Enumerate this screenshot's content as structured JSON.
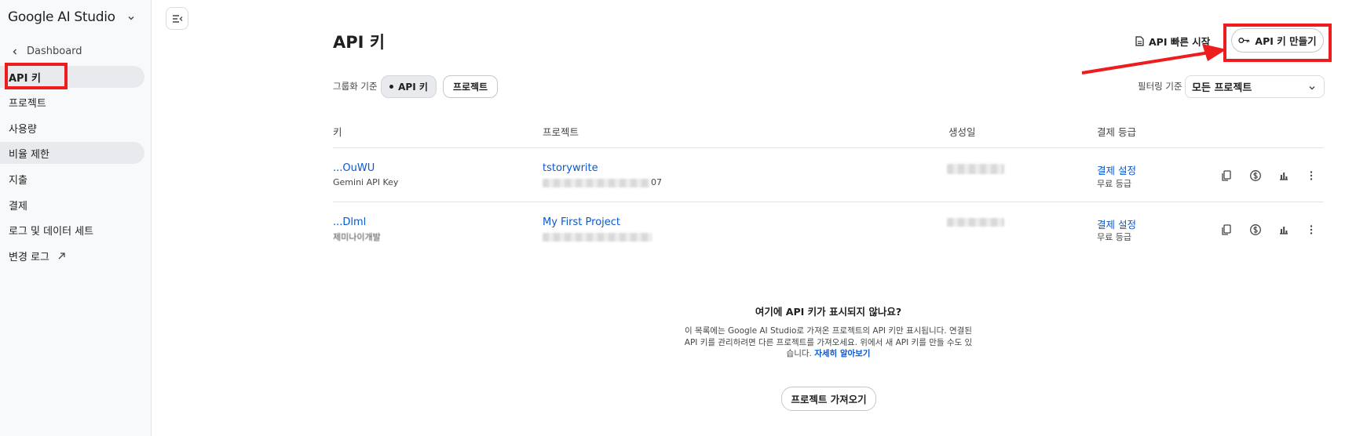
{
  "sidebar": {
    "brand": "Google AI Studio",
    "back_label": "Dashboard",
    "items": [
      {
        "label": "API 키",
        "state": "active"
      },
      {
        "label": "프로젝트",
        "state": ""
      },
      {
        "label": "사용량",
        "state": ""
      },
      {
        "label": "비율 제한",
        "state": "hover"
      },
      {
        "label": "지출",
        "state": ""
      },
      {
        "label": "결제",
        "state": ""
      },
      {
        "label": "로그 및 데이터 세트",
        "state": ""
      },
      {
        "label": "변경 로그",
        "state": "external"
      }
    ]
  },
  "header": {
    "title": "API 키",
    "quickstart_label": "API 빠른 시작",
    "create_label": "API 키 만들기"
  },
  "toolbar": {
    "group_label": "그룹화 기준",
    "group_options": [
      "API 키",
      "프로젝트"
    ],
    "filter_label": "필터링 기준",
    "filter_value": "모든 프로젝트"
  },
  "table": {
    "columns": [
      "키",
      "프로젝트",
      "생성일",
      "결제 등급"
    ],
    "rows": [
      {
        "key": "...OuWU",
        "key_sub": "Gemini API Key",
        "project": "tstorywrite",
        "project_sub_suffix": "07",
        "billing_link": "결제 설정",
        "billing_tier": "무료 등급"
      },
      {
        "key": "...Dlml",
        "key_sub": "제미나이개발",
        "project": "My First Project",
        "project_sub_suffix": "",
        "billing_link": "결제 설정",
        "billing_tier": "무료 등급"
      }
    ]
  },
  "empty_state": {
    "title": "여기에 API 키가 표시되지 않나요?",
    "body": "이 목록에는 Google AI Studio로 가져온 프로젝트의 API 키만 표시됩니다. 연결된 API 키를 관리하려면 다른 프로젝트를 가져오세요. 위에서 새 API 키를 만들 수도 있습니다. ",
    "learn_more": "자세히 알아보기",
    "import_label": "프로젝트 가져오기"
  },
  "icons": {
    "row_actions": [
      "copy-icon",
      "billing-icon",
      "usage-chart-icon",
      "more-vert-icon"
    ]
  },
  "colors": {
    "link": "#0b57d0",
    "annotation": "#ee1c1c",
    "sidebar_bg": "#f8f9fa",
    "active_bg": "#e8eaed"
  }
}
